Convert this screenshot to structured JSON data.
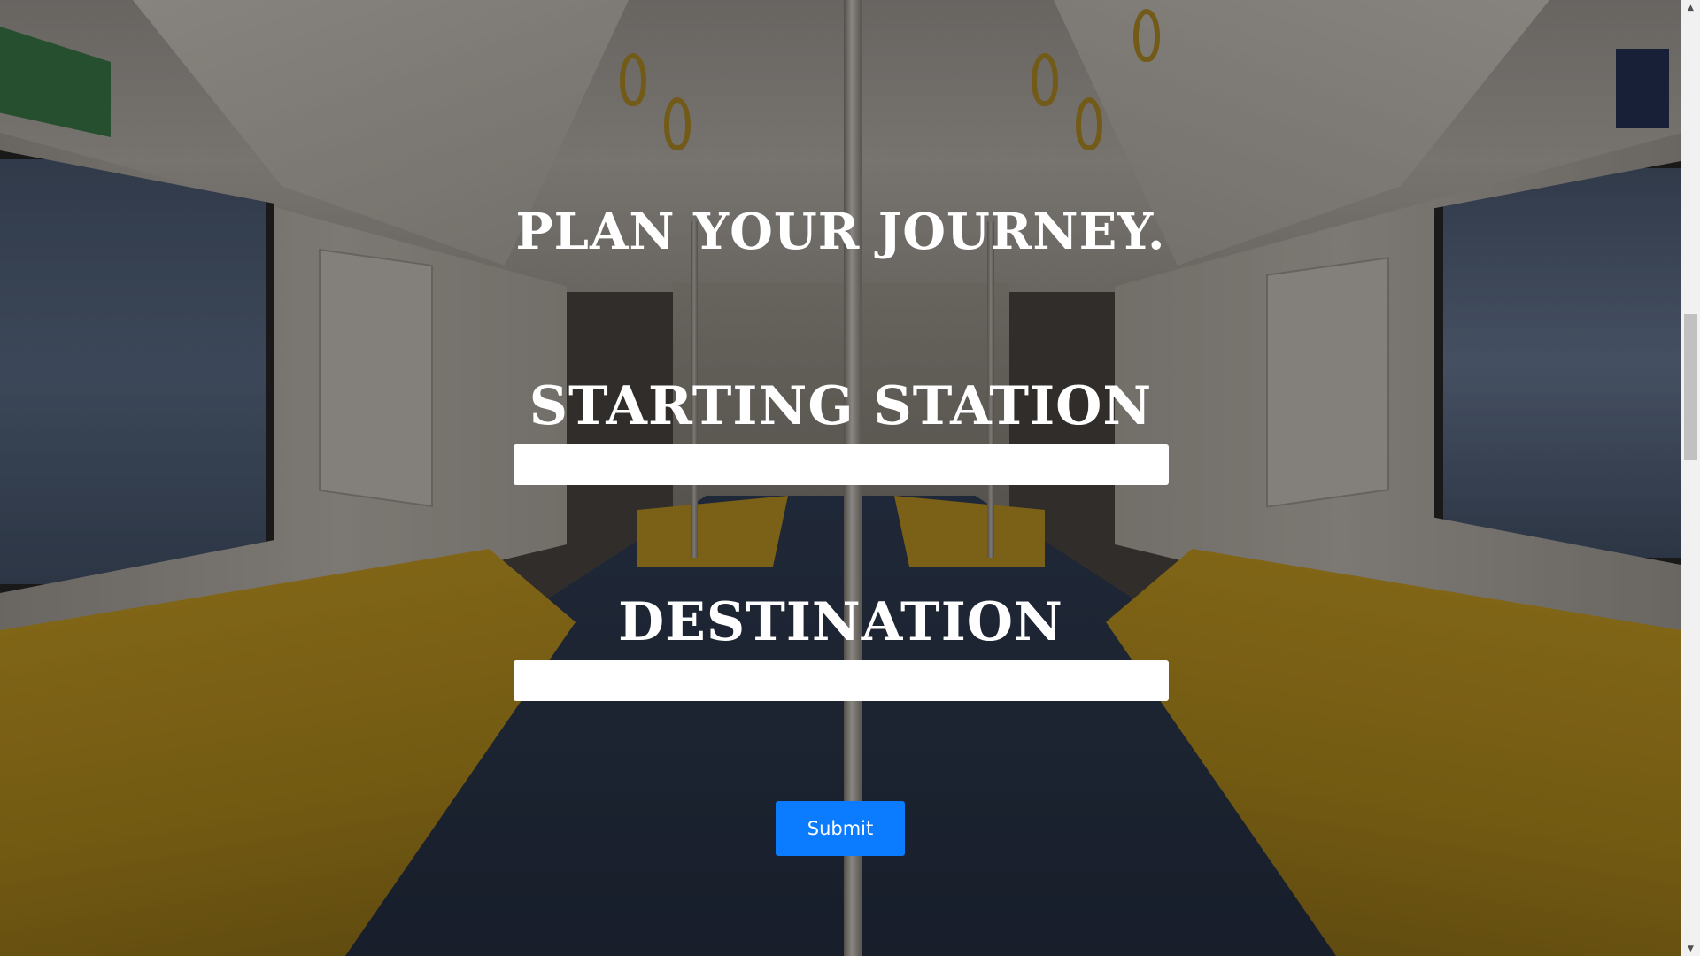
{
  "page": {
    "title": "PLAN YOUR JOURNEY."
  },
  "form": {
    "starting_station_label": "STARTING STATION",
    "starting_station_value": "",
    "destination_label": "DESTINATION",
    "destination_value": "",
    "submit_label": "Submit"
  },
  "scrollbar": {
    "up_arrow_icon": "triangle-up-icon",
    "down_arrow_icon": "triangle-down-icon"
  },
  "colors": {
    "submit_button": "#0b7bff",
    "heading_text": "#ffffff",
    "input_background": "#ffffff"
  }
}
